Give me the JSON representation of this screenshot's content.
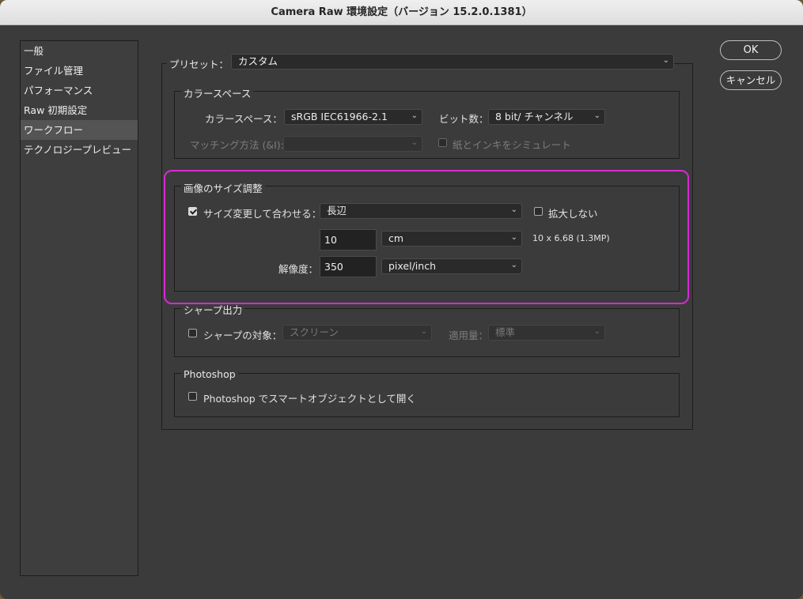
{
  "window": {
    "title": "Camera Raw 環境設定（バージョン 15.2.0.1381）"
  },
  "sidebar": {
    "items": [
      {
        "label": "一般"
      },
      {
        "label": "ファイル管理"
      },
      {
        "label": "パフォーマンス"
      },
      {
        "label": "Raw 初期設定"
      },
      {
        "label": "ワークフロー",
        "selected": true
      },
      {
        "label": "テクノロジープレビュー"
      }
    ]
  },
  "preset": {
    "label": "プリセット：",
    "value": "カスタム"
  },
  "color_space": {
    "group_title": "カラースペース",
    "space_label": "カラースペース：",
    "space_value": "sRGB IEC61966-2.1",
    "depth_label": "ビット数：",
    "depth_value": "8 bit/ チャンネル",
    "intent_label": "マッチング方法 (&I):",
    "intent_value": "",
    "simulate_label": "紙とインキをシミュレート",
    "simulate_checked": false
  },
  "image_sizing": {
    "group_title": "画像のサイズ調整",
    "resize_label": "サイズ変更して合わせる：",
    "resize_checked": true,
    "resize_mode": "長辺",
    "no_enlarge_label": "拡大しない",
    "no_enlarge_checked": false,
    "size_value": "10",
    "size_unit": "cm",
    "dimensions_info": "10 x 6.68 (1.3MP)",
    "resolution_label": "解像度：",
    "resolution_value": "350",
    "resolution_unit": "pixel/inch"
  },
  "sharpen": {
    "group_title": "シャープ出力",
    "target_label": "シャープの対象：",
    "target_checked": false,
    "target_value": "スクリーン",
    "amount_label": "適用量：",
    "amount_value": "標準"
  },
  "photoshop": {
    "group_title": "Photoshop",
    "smart_object_label": "Photoshop でスマートオブジェクトとして開く",
    "smart_object_checked": false
  },
  "buttons": {
    "ok": "OK",
    "cancel": "キャンセル"
  },
  "colors": {
    "highlight": "#d62ad3",
    "panel_bg": "#3b3b3b",
    "selected_item": "#545454"
  }
}
